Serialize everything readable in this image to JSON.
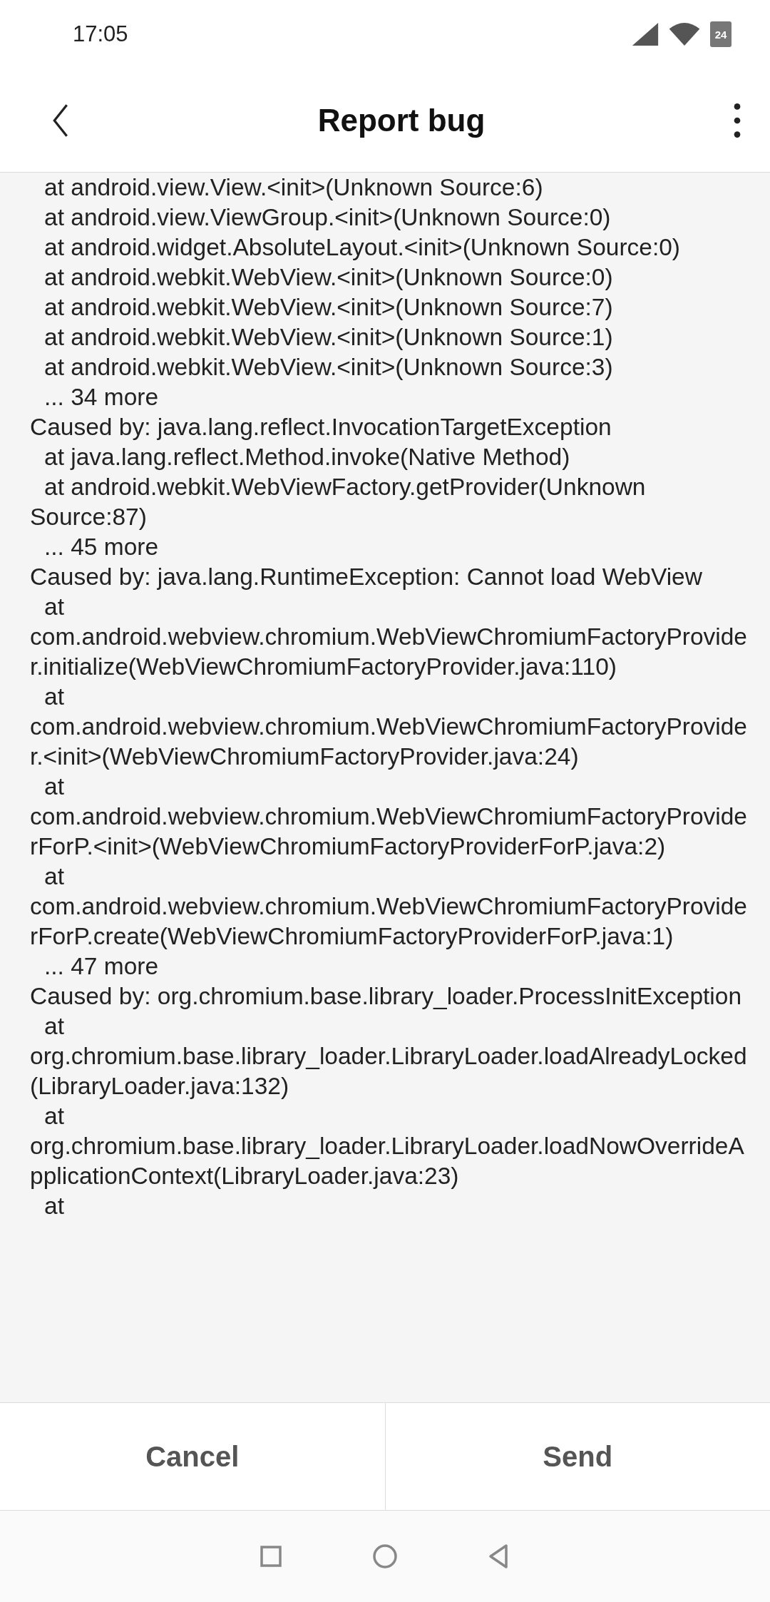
{
  "status_bar": {
    "time": "17:05",
    "battery": "24"
  },
  "header": {
    "title": "Report bug"
  },
  "log_lines": [
    {
      "text": "at android.view.View.<init>(Unknown Source:6)",
      "indent": true
    },
    {
      "text": "at android.view.ViewGroup.<init>(Unknown Source:0)",
      "indent": true
    },
    {
      "text": "at android.widget.AbsoluteLayout.<init>(Unknown Source:0)",
      "indent": true
    },
    {
      "text": "at android.webkit.WebView.<init>(Unknown Source:0)",
      "indent": true
    },
    {
      "text": "at android.webkit.WebView.<init>(Unknown Source:7)",
      "indent": true
    },
    {
      "text": "at android.webkit.WebView.<init>(Unknown Source:1)",
      "indent": true
    },
    {
      "text": "at android.webkit.WebView.<init>(Unknown Source:3)",
      "indent": true
    },
    {
      "text": "... 34 more",
      "indent": true
    },
    {
      "text": "Caused by: java.lang.reflect.InvocationTargetException",
      "indent": false
    },
    {
      "text": "at java.lang.reflect.Method.invoke(Native Method)",
      "indent": true
    },
    {
      "text": "at android.webkit.WebViewFactory.getProvider(Unknown Source:87)",
      "indent": true
    },
    {
      "text": "... 45 more",
      "indent": true
    },
    {
      "text": "Caused by: java.lang.RuntimeException: Cannot load WebView",
      "indent": false
    },
    {
      "text": "at com.android.webview.chromium.WebViewChromiumFactoryProvider.initialize(WebViewChromiumFactoryProvider.java:110)",
      "indent": true
    },
    {
      "text": "at com.android.webview.chromium.WebViewChromiumFactoryProvider.<init>(WebViewChromiumFactoryProvider.java:24)",
      "indent": true
    },
    {
      "text": "at com.android.webview.chromium.WebViewChromiumFactoryProviderForP.<init>(WebViewChromiumFactoryProviderForP.java:2)",
      "indent": true
    },
    {
      "text": "at com.android.webview.chromium.WebViewChromiumFactoryProviderForP.create(WebViewChromiumFactoryProviderForP.java:1)",
      "indent": true
    },
    {
      "text": "... 47 more",
      "indent": true
    },
    {
      "text": "Caused by: org.chromium.base.library_loader.ProcessInitException",
      "indent": false
    },
    {
      "text": "at org.chromium.base.library_loader.LibraryLoader.loadAlreadyLocked(LibraryLoader.java:132)",
      "indent": true
    },
    {
      "text": "at org.chromium.base.library_loader.LibraryLoader.loadNowOverrideApplicationContext(LibraryLoader.java:23)",
      "indent": true
    },
    {
      "text": "at",
      "indent": true
    }
  ],
  "buttons": [
    {
      "label": "Cancel"
    },
    {
      "label": "Send"
    }
  ]
}
